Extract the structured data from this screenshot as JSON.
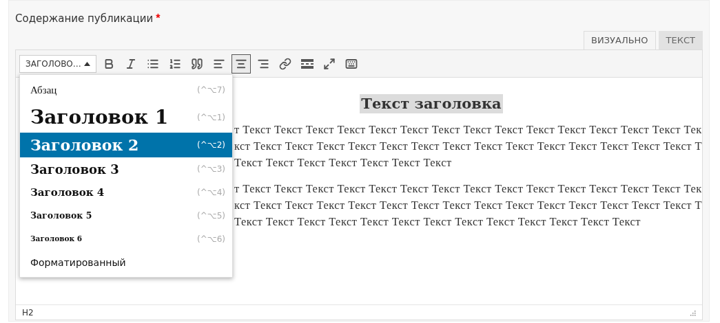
{
  "field_label": {
    "text": "Содержание публикации",
    "required_mark": "*"
  },
  "tabs": [
    {
      "label": "ВИЗУАЛЬНО",
      "selected": true
    },
    {
      "label": "ТЕКСТ",
      "selected": false
    }
  ],
  "toolbar": {
    "format_select": "ЗАГОЛОВО…",
    "buttons": [
      {
        "kind": "bold",
        "active": false
      },
      {
        "kind": "italic",
        "active": false
      },
      {
        "kind": "bullets",
        "active": false
      },
      {
        "kind": "numbers",
        "active": false
      },
      {
        "kind": "quote",
        "active": false
      },
      {
        "kind": "align-left",
        "active": false
      },
      {
        "kind": "align-center",
        "active": true
      },
      {
        "kind": "align-right",
        "active": false
      },
      {
        "kind": "link",
        "active": false
      },
      {
        "kind": "more",
        "active": false
      },
      {
        "kind": "fullscreen",
        "active": false
      },
      {
        "kind": "toolbar-toggle",
        "active": false
      }
    ]
  },
  "format_menu": [
    {
      "kind": "p",
      "label": "Абзац",
      "shortcut": "(^⌥7)",
      "selected": false
    },
    {
      "kind": "h1",
      "label": "Заголовок 1",
      "shortcut": "(^⌥1)",
      "selected": false
    },
    {
      "kind": "h2",
      "label": "Заголовок 2",
      "shortcut": "(^⌥2)",
      "selected": true
    },
    {
      "kind": "h3",
      "label": "Заголовок 3",
      "shortcut": "(^⌥3)",
      "selected": false
    },
    {
      "kind": "h4",
      "label": "Заголовок 4",
      "shortcut": "(^⌥4)",
      "selected": false
    },
    {
      "kind": "h5",
      "label": "Заголовок 5",
      "shortcut": "(^⌥5)",
      "selected": false
    },
    {
      "kind": "h6",
      "label": "Заголовок 6",
      "shortcut": "(^⌥6)",
      "selected": false
    },
    {
      "kind": "pre",
      "label": "Форматированный",
      "selected": false
    }
  ],
  "content": {
    "heading": "Текст заголовка",
    "paragraphs": [
      {
        "lines": [
          "т Текст Текст Текст Текст Текст Текст Текст Текст Текст Текст Текст Текст Текст Текст Тек",
          "кст Текст Текст Текст Текст Текст Текст Текст Текст Текст Текст Текст Текст Текст Текст Т",
          "Текст Текст Текст Текст Текст Текст Текст"
        ]
      },
      {
        "lines": [
          "т Текст Текст Текст Текст Текст Текст Текст Текст Текст Текст Текст Текст Текст Текст Тек",
          "кст Текст Текст Текст Текст Текст Текст Текст Текст Текст Текст Текст Текст Текст Текст Т",
          "Текст Текст Текст Текст Текст Текст Текст Текст Текст Текст Текст Текст Текст"
        ]
      }
    ]
  },
  "status_bar": {
    "path": "H2"
  }
}
